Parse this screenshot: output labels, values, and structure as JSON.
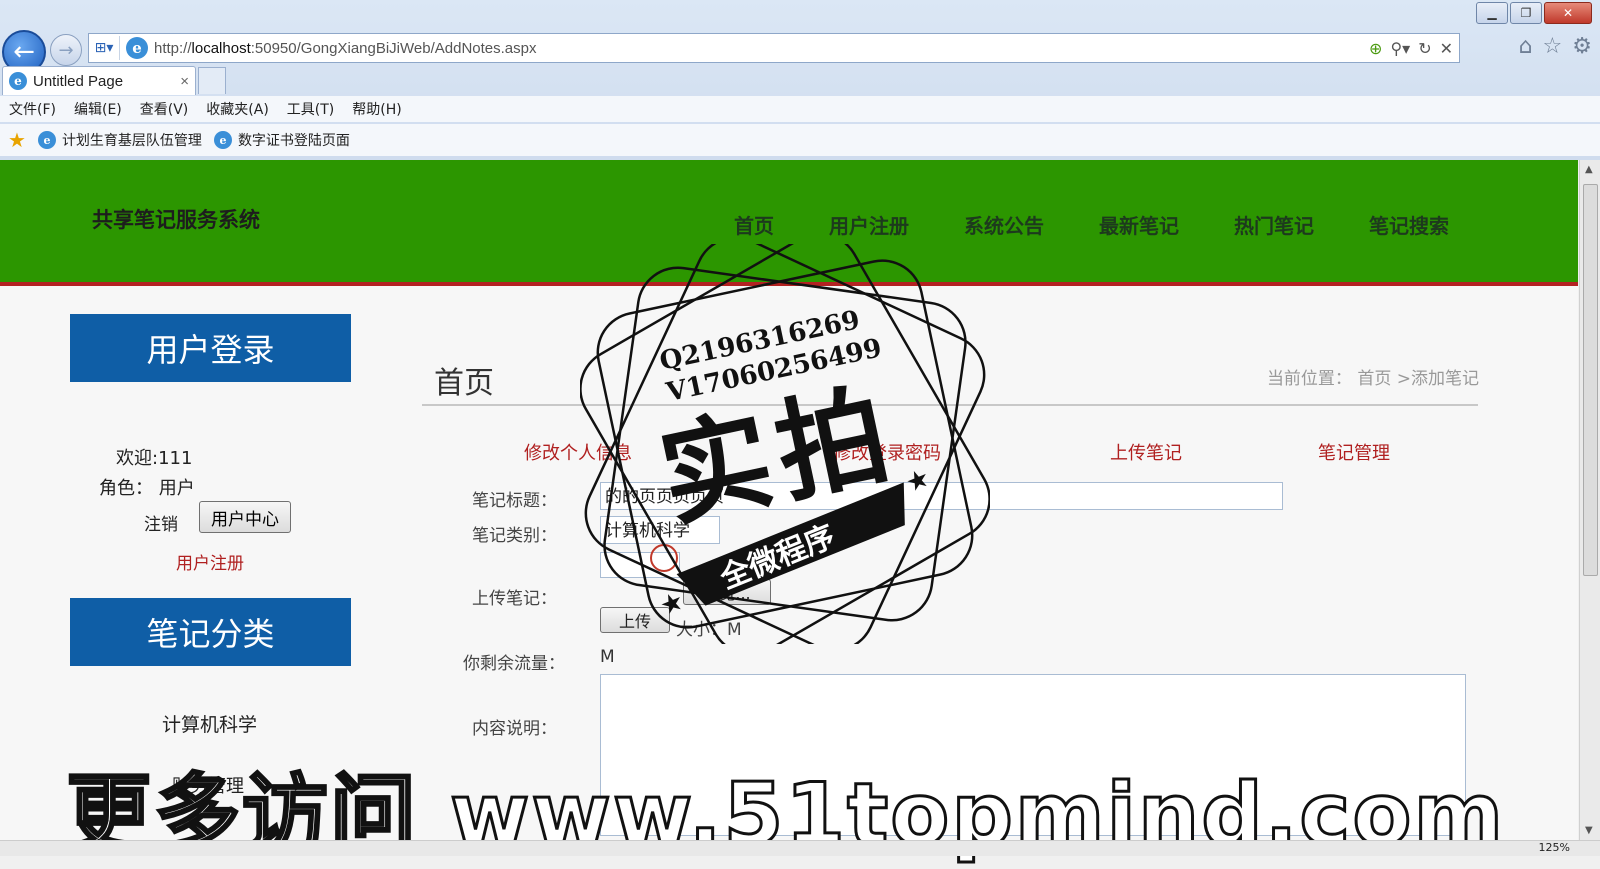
{
  "browser": {
    "url_prefix": "http://",
    "url_host": "localhost",
    "url_rest": ":50950/GongXiangBiJiWeb/AddNotes.aspx",
    "tab_title": "Untitled Page",
    "tab_close": "×",
    "menu": [
      "文件(F)",
      "编辑(E)",
      "查看(V)",
      "收藏夹(A)",
      "工具(T)",
      "帮助(H)"
    ],
    "favorites": [
      "计划生育基层队伍管理",
      "数字证书登陆页面"
    ],
    "zoom": "125%"
  },
  "header": {
    "site_title": "共享笔记服务系统",
    "nav": [
      "首页",
      "用户注册",
      "系统公告",
      "最新笔记",
      "热门笔记",
      "笔记搜索"
    ]
  },
  "sidebar": {
    "login_title": "用户登录",
    "welcome": "欢迎:111",
    "role": "角色： 用户",
    "logout": "注销",
    "user_center_btn": "用户中心",
    "register_link": "用户注册",
    "category_title": "笔记分类",
    "categories": [
      "计算机科学",
      "财务管理"
    ]
  },
  "main": {
    "title": "首页",
    "breadcrumb": "当前位置： 首页 >添加笔记",
    "sublinks": [
      "修改个人信息",
      "修改登录密码",
      "上传笔记",
      "笔记管理"
    ],
    "form": {
      "title_label": "笔记标题：",
      "title_value": "的的页页页页页",
      "category_label": "笔记类别：",
      "category_value": "计算机科学",
      "upload_label": "上传笔记：",
      "browse_btn": "浏览...",
      "upload_btn": "上传",
      "size_info": "大小：M",
      "remaining_label": "你剩余流量：",
      "remaining_value": "M",
      "content_label": "内容说明："
    }
  },
  "watermark": {
    "stamp_contacts": [
      "Q2196316269",
      "V17060256499"
    ],
    "stamp_big": "实拍",
    "stamp_banner": "全微程序",
    "bottom_text": "更多访问 www.51topmind.com"
  },
  "colors": {
    "header_green": "#2c9600",
    "header_border": "#b32222",
    "sidebox_blue": "#0f5ea6",
    "link_red": "#b02020"
  }
}
